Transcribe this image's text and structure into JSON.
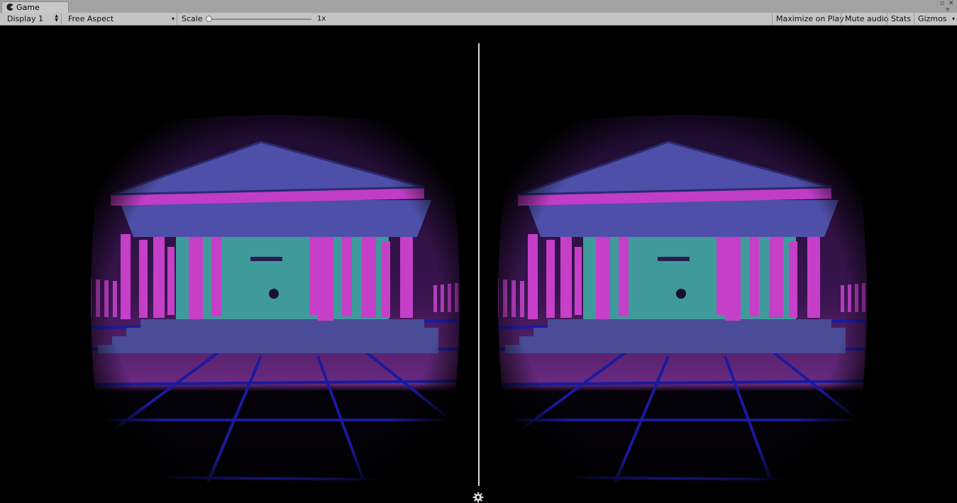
{
  "tab": {
    "title": "Game",
    "icon": "pacman-icon"
  },
  "toolbar": {
    "display": "Display 1",
    "aspect": "Free Aspect",
    "scale_label": "Scale",
    "scale_value": "1x",
    "maximize": "Maximize on Play",
    "mute": "Mute audio",
    "stats": "Stats",
    "gizmos": "Gizmos"
  },
  "scene": {
    "sky_top": "#1a0b2b",
    "sky_horizon": "#6a2a80",
    "ground_grid": "#1a1a9e",
    "roof": "#4e4fa8",
    "cornice": "#c13dc7",
    "columns": "#c63fc8",
    "cella": "#3f9b9b",
    "steps": "#4a4c98"
  },
  "controls": {
    "settings": "gear-icon"
  }
}
